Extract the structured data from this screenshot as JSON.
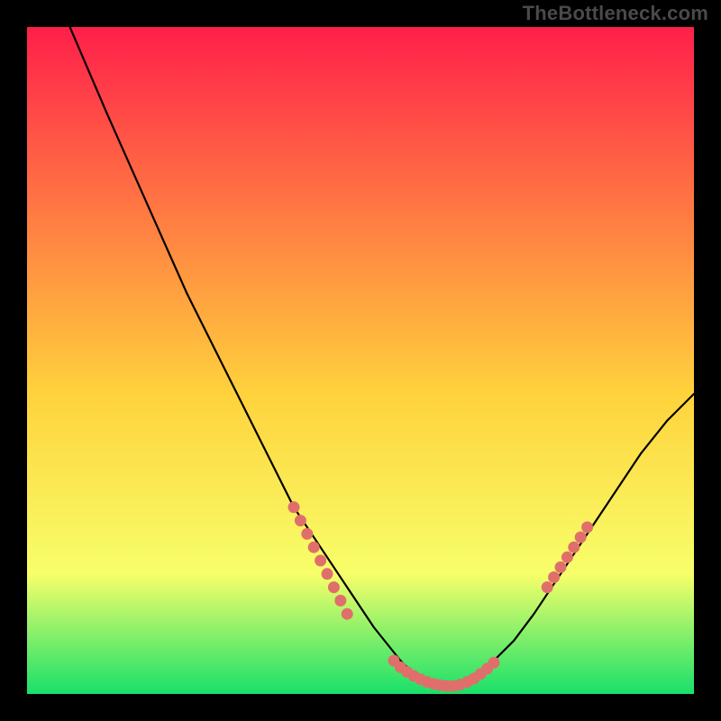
{
  "watermark": "TheBottleneck.com",
  "colors": {
    "bg": "#000000",
    "grad_top": "#ff1f4a",
    "grad_mid": "#ffd23c",
    "grad_low": "#f7ff6a",
    "grad_bottom": "#18e06a",
    "curve": "#000000",
    "dot": "#e06f6b",
    "watermark": "#4a4a4a"
  },
  "chart_data": {
    "type": "line",
    "title": "",
    "xlabel": "",
    "ylabel": "",
    "xlim": [
      0,
      100
    ],
    "ylim": [
      0,
      100
    ],
    "grid": false,
    "legend": false,
    "series": [
      {
        "name": "bottleneck-curve",
        "x": [
          0,
          3,
          6,
          9,
          12,
          16,
          20,
          24,
          28,
          32,
          36,
          40,
          44,
          48,
          52,
          56,
          58,
          60,
          62,
          64,
          66,
          68,
          70,
          73,
          76,
          80,
          84,
          88,
          92,
          96,
          100
        ],
        "y": [
          115,
          108,
          101,
          94,
          87,
          78,
          69,
          60,
          52,
          44,
          36,
          28,
          22,
          16,
          10,
          5,
          3,
          2,
          1,
          1,
          2,
          3,
          5,
          8,
          12,
          18,
          24,
          30,
          36,
          41,
          45
        ]
      }
    ],
    "markers": [
      {
        "name": "left-cluster",
        "x": [
          40,
          41,
          42,
          43,
          44,
          45,
          46,
          47,
          48
        ],
        "y": [
          28,
          26,
          24,
          22,
          20,
          18,
          16,
          14,
          12
        ]
      },
      {
        "name": "valley-cluster",
        "x": [
          55,
          56,
          57,
          58,
          59,
          60,
          61,
          62,
          63,
          64,
          65,
          66,
          67,
          68,
          69,
          70
        ],
        "y": [
          5,
          4,
          3.3,
          2.7,
          2.2,
          1.8,
          1.5,
          1.3,
          1.2,
          1.2,
          1.4,
          1.8,
          2.3,
          3.0,
          3.8,
          4.7
        ]
      },
      {
        "name": "right-cluster",
        "x": [
          78,
          79,
          80,
          81,
          82,
          83,
          84
        ],
        "y": [
          16,
          17.5,
          19,
          20.5,
          22,
          23.5,
          25
        ]
      }
    ]
  }
}
